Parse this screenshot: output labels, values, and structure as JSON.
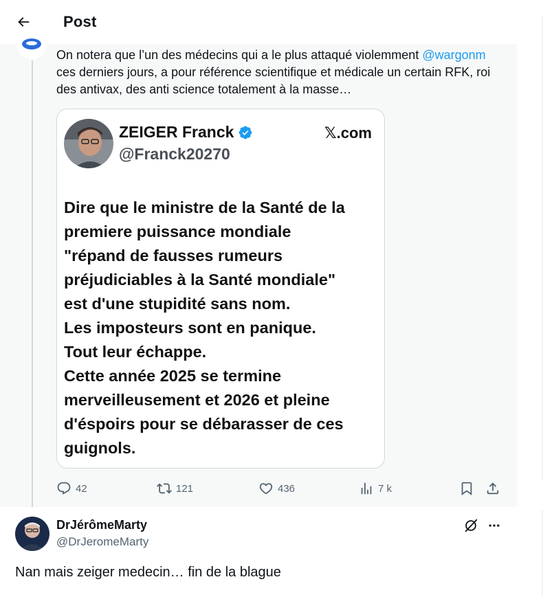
{
  "header": {
    "title": "Post",
    "back_icon": "arrow-left-icon"
  },
  "parent_tweet": {
    "text_before": "On notera que l’un des médecins qui a le plus attaqué violemment ",
    "mention": "@wargonm",
    "text_after": " ces derniers jours, a pour référence scientifique et médicale un certain RFK, roi des antivax, des anti science totalement à la masse…",
    "media": {
      "name": "ZEIGER Franck",
      "handle": "@Franck20270",
      "brand": "𝕏.com",
      "verified_color": "#1d9bf0",
      "body": "Dire que le ministre de la Santé de la\npremiere puissance mondiale\n\"répand de fausses rumeurs\npréjudiciables à la Santé mondiale\"\nest d'une stupidité sans nom.\nLes imposteurs sont en panique.\nTout leur échappe.\nCette année 2025 se termine\nmerveilleusement et 2026 et pleine\nd'éspoirs pour se débarasser de ces\nguignols."
    },
    "actions": {
      "replies": "42",
      "retweets": "121",
      "likes": "436",
      "views": "7 k"
    }
  },
  "reply_tweet": {
    "name": "DrJérômeMarty",
    "handle": "@DrJeromeMarty",
    "text": "Nan mais zeiger medecin… fin de la blague"
  },
  "colors": {
    "accent": "#1d9bf0",
    "muted": "#536471",
    "thread_line": "#cfd9de",
    "parent_bg": "#f7f9f9"
  }
}
